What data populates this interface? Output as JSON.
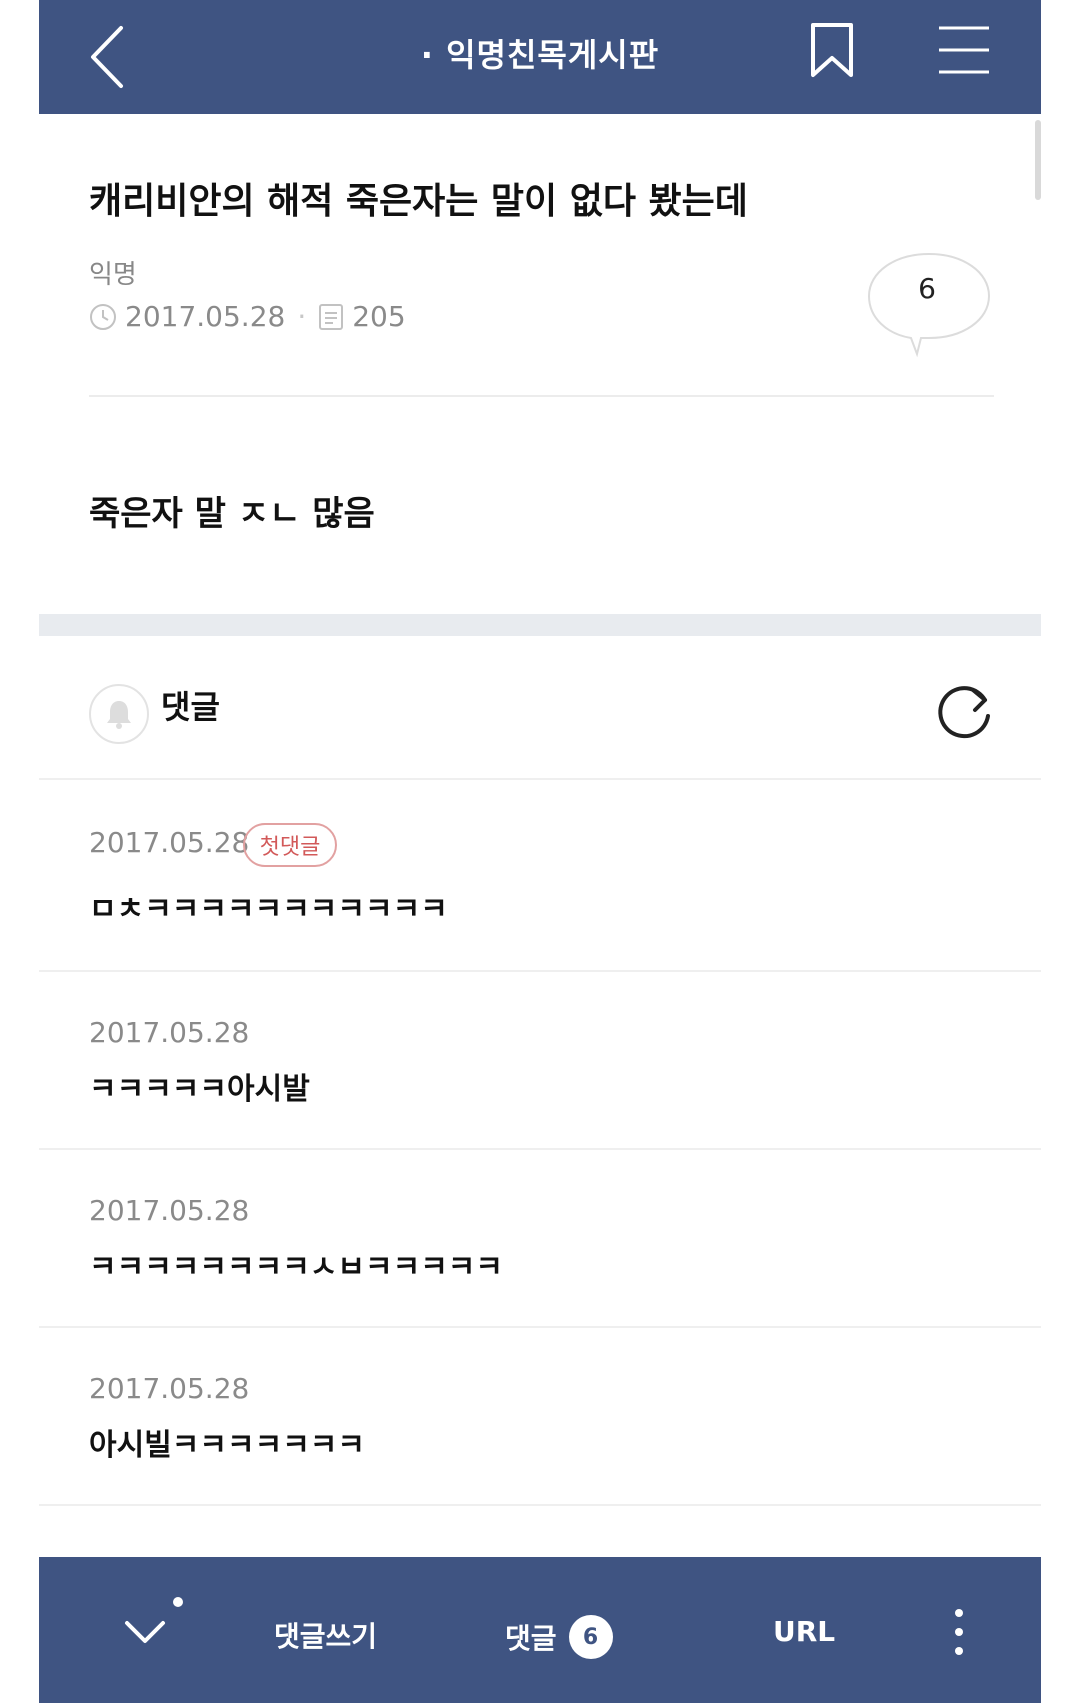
{
  "header": {
    "title": "· 익명친목게시판",
    "back_icon": "chevron-left-icon",
    "bookmark_icon": "bookmark-icon",
    "menu_icon": "hamburger-menu-icon"
  },
  "post": {
    "title": "캐리비안의 해적 죽은자는 말이 없다 봤는데",
    "author": "익명",
    "date": "2017.05.28",
    "views": "205",
    "comment_count": "6",
    "body": "죽은자 말 ㅈㄴ 많음"
  },
  "comments_section": {
    "title": "댓글",
    "bell_icon": "bell-icon",
    "refresh_icon": "refresh-icon",
    "items": [
      {
        "date": "2017.05.28",
        "badge": "첫댓글",
        "text": "ㅁㅊㅋㅋㅋㅋㅋㅋㅋㅋㅋㅋㅋ"
      },
      {
        "date": "2017.05.28",
        "text": "ㅋㅋㅋㅋㅋ아시발"
      },
      {
        "date": "2017.05.28",
        "text": "ㅋㅋㅋㅋㅋㅋㅋㅋㅅㅂㅋㅋㅋㅋㅋ"
      },
      {
        "date": "2017.05.28",
        "text": "아시빌ㅋㅋㅋㅋㅋㅋㅋ"
      }
    ]
  },
  "bottom_bar": {
    "write_label": "댓글쓰기",
    "comments_label": "댓글",
    "comments_count": "6",
    "url_label": "URL"
  },
  "colors": {
    "bar": "#3f5482",
    "badge_red": "#d25959"
  }
}
